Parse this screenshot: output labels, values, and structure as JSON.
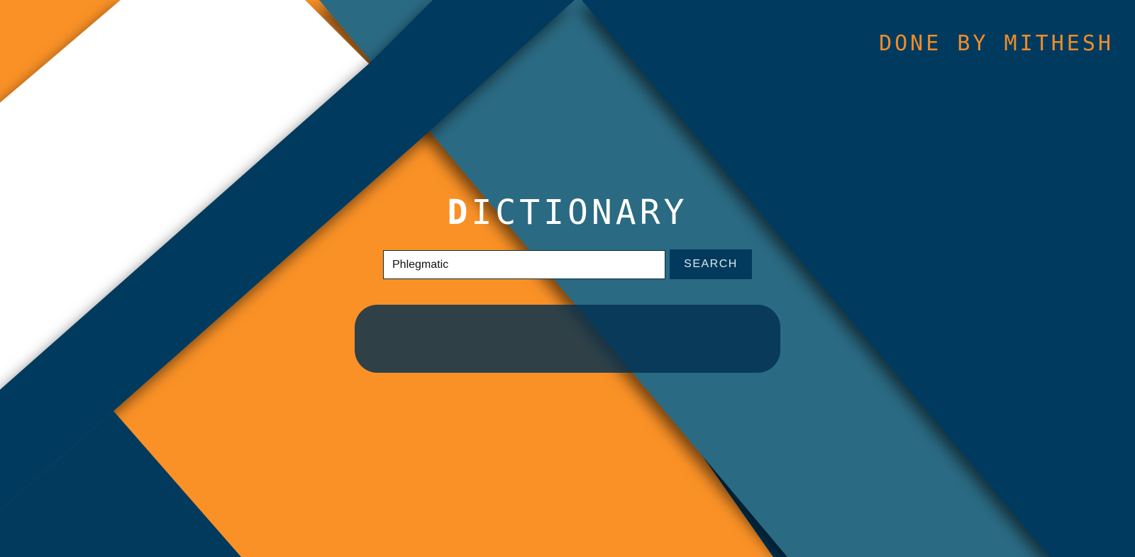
{
  "header": {
    "credit_first_letter": "D",
    "credit_rest": "ONE BY MITHESH"
  },
  "main": {
    "title_first_letter": "D",
    "title_rest": "ICTIONARY",
    "search": {
      "value": "Phlegmatic",
      "button_label": "SEARCH"
    },
    "result": ""
  },
  "colors": {
    "navy": "#023a5e",
    "teal": "#2c6b83",
    "orange": "#fa9126",
    "white": "#ffffff",
    "credit_orange": "#f08c2a"
  }
}
